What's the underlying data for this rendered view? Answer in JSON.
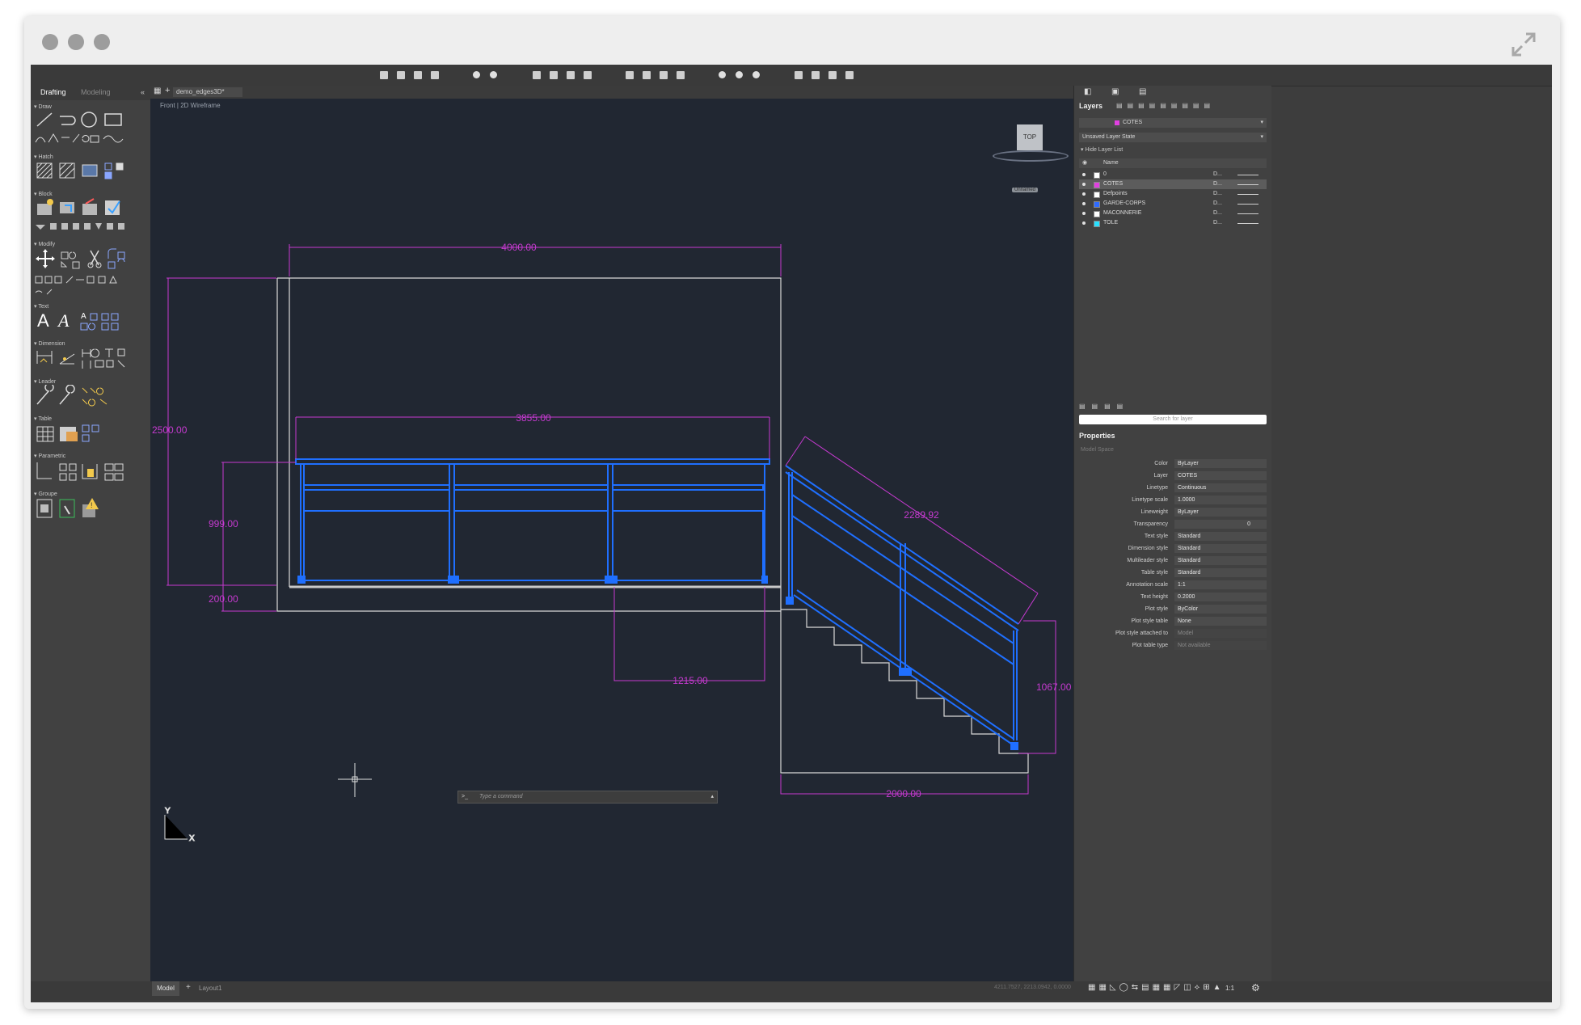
{
  "window": {
    "title": "demo_edges3D*",
    "view_label": "Front | 2D Wireframe",
    "viewcube_label": "TOP",
    "unnamed_badge": "Unnamed",
    "colors": {
      "accent_blue": "#1f6fff",
      "dimension_magenta": "#d63ad6",
      "canvas": "#212732"
    }
  },
  "left_panel": {
    "tabs": [
      "Drafting",
      "Modeling"
    ],
    "sections": [
      "Draw",
      "Hatch",
      "Block",
      "Modify",
      "Text",
      "Dimension",
      "Leader",
      "Table",
      "Parametric",
      "Groupe"
    ]
  },
  "command": {
    "prompt": ">_",
    "placeholder": "Type a command"
  },
  "bottom": {
    "tabs": [
      "Model",
      "Layout1"
    ],
    "coords": "4211.7527, 2213.0942, 0.0000",
    "scale": "1:1"
  },
  "drawing": {
    "dimensions": [
      "4000.00",
      "3855.00",
      "2500.00",
      "999.00",
      "200.00",
      "1215.00",
      "2289.92",
      "1067.00",
      "2000.00"
    ],
    "axis_labels": {
      "x": "X",
      "y": "Y"
    }
  },
  "layers_panel": {
    "title": "Layers",
    "current_layer": "COTES",
    "layer_state": "Unsaved Layer State",
    "hide_list": "Hide Layer List",
    "name_header": "Name",
    "layers": [
      {
        "name": "0",
        "color": "#ffffff",
        "desc": "D...",
        "selected": false
      },
      {
        "name": "COTES",
        "color": "#e040e0",
        "desc": "D...",
        "selected": true
      },
      {
        "name": "Defpoints",
        "color": "#ffffff",
        "desc": "D...",
        "selected": false
      },
      {
        "name": "GARDE-CORPS",
        "color": "#2f6bff",
        "desc": "D...",
        "selected": false
      },
      {
        "name": "MACONNERIE",
        "color": "#ffffff",
        "desc": "D...",
        "selected": false
      },
      {
        "name": "TOLE",
        "color": "#28e0ff",
        "desc": "D...",
        "selected": false
      }
    ],
    "search_placeholder": "Search for layer"
  },
  "properties_panel": {
    "title": "Properties",
    "context": "Model Space",
    "rows": [
      {
        "key": "Color",
        "value": "ByLayer"
      },
      {
        "key": "Layer",
        "value": "COTES"
      },
      {
        "key": "Linetype",
        "value": "Continuous"
      },
      {
        "key": "Linetype scale",
        "value": "1.0000"
      },
      {
        "key": "Lineweight",
        "value": "ByLayer"
      },
      {
        "key": "Transparency",
        "value": "0"
      },
      {
        "key": "Text style",
        "value": "Standard"
      },
      {
        "key": "Dimension style",
        "value": "Standard"
      },
      {
        "key": "Multileader style",
        "value": "Standard"
      },
      {
        "key": "Table style",
        "value": "Standard"
      },
      {
        "key": "Annotation scale",
        "value": "1:1"
      },
      {
        "key": "Text height",
        "value": "0.2000"
      },
      {
        "key": "Plot style",
        "value": "ByColor"
      },
      {
        "key": "Plot style table",
        "value": "None"
      },
      {
        "key": "Plot style attached to",
        "value": "Model"
      },
      {
        "key": "Plot table type",
        "value": "Not available"
      }
    ]
  }
}
